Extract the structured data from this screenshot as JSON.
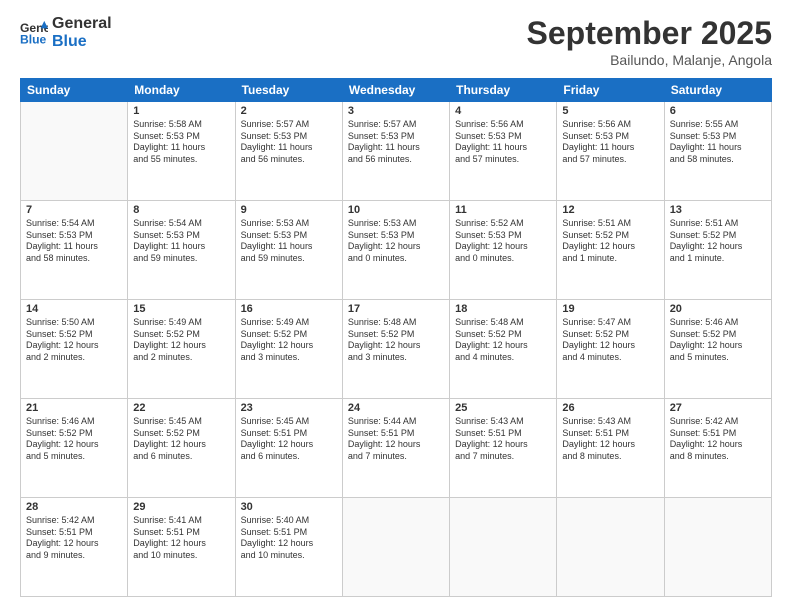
{
  "header": {
    "logo_line1": "General",
    "logo_line2": "Blue",
    "month_title": "September 2025",
    "location": "Bailundo, Malanje, Angola"
  },
  "days_of_week": [
    "Sunday",
    "Monday",
    "Tuesday",
    "Wednesday",
    "Thursday",
    "Friday",
    "Saturday"
  ],
  "weeks": [
    [
      {
        "day": "",
        "info": ""
      },
      {
        "day": "1",
        "info": "Sunrise: 5:58 AM\nSunset: 5:53 PM\nDaylight: 11 hours\nand 55 minutes."
      },
      {
        "day": "2",
        "info": "Sunrise: 5:57 AM\nSunset: 5:53 PM\nDaylight: 11 hours\nand 56 minutes."
      },
      {
        "day": "3",
        "info": "Sunrise: 5:57 AM\nSunset: 5:53 PM\nDaylight: 11 hours\nand 56 minutes."
      },
      {
        "day": "4",
        "info": "Sunrise: 5:56 AM\nSunset: 5:53 PM\nDaylight: 11 hours\nand 57 minutes."
      },
      {
        "day": "5",
        "info": "Sunrise: 5:56 AM\nSunset: 5:53 PM\nDaylight: 11 hours\nand 57 minutes."
      },
      {
        "day": "6",
        "info": "Sunrise: 5:55 AM\nSunset: 5:53 PM\nDaylight: 11 hours\nand 58 minutes."
      }
    ],
    [
      {
        "day": "7",
        "info": "Sunrise: 5:54 AM\nSunset: 5:53 PM\nDaylight: 11 hours\nand 58 minutes."
      },
      {
        "day": "8",
        "info": "Sunrise: 5:54 AM\nSunset: 5:53 PM\nDaylight: 11 hours\nand 59 minutes."
      },
      {
        "day": "9",
        "info": "Sunrise: 5:53 AM\nSunset: 5:53 PM\nDaylight: 11 hours\nand 59 minutes."
      },
      {
        "day": "10",
        "info": "Sunrise: 5:53 AM\nSunset: 5:53 PM\nDaylight: 12 hours\nand 0 minutes."
      },
      {
        "day": "11",
        "info": "Sunrise: 5:52 AM\nSunset: 5:53 PM\nDaylight: 12 hours\nand 0 minutes."
      },
      {
        "day": "12",
        "info": "Sunrise: 5:51 AM\nSunset: 5:52 PM\nDaylight: 12 hours\nand 1 minute."
      },
      {
        "day": "13",
        "info": "Sunrise: 5:51 AM\nSunset: 5:52 PM\nDaylight: 12 hours\nand 1 minute."
      }
    ],
    [
      {
        "day": "14",
        "info": "Sunrise: 5:50 AM\nSunset: 5:52 PM\nDaylight: 12 hours\nand 2 minutes."
      },
      {
        "day": "15",
        "info": "Sunrise: 5:49 AM\nSunset: 5:52 PM\nDaylight: 12 hours\nand 2 minutes."
      },
      {
        "day": "16",
        "info": "Sunrise: 5:49 AM\nSunset: 5:52 PM\nDaylight: 12 hours\nand 3 minutes."
      },
      {
        "day": "17",
        "info": "Sunrise: 5:48 AM\nSunset: 5:52 PM\nDaylight: 12 hours\nand 3 minutes."
      },
      {
        "day": "18",
        "info": "Sunrise: 5:48 AM\nSunset: 5:52 PM\nDaylight: 12 hours\nand 4 minutes."
      },
      {
        "day": "19",
        "info": "Sunrise: 5:47 AM\nSunset: 5:52 PM\nDaylight: 12 hours\nand 4 minutes."
      },
      {
        "day": "20",
        "info": "Sunrise: 5:46 AM\nSunset: 5:52 PM\nDaylight: 12 hours\nand 5 minutes."
      }
    ],
    [
      {
        "day": "21",
        "info": "Sunrise: 5:46 AM\nSunset: 5:52 PM\nDaylight: 12 hours\nand 5 minutes."
      },
      {
        "day": "22",
        "info": "Sunrise: 5:45 AM\nSunset: 5:52 PM\nDaylight: 12 hours\nand 6 minutes."
      },
      {
        "day": "23",
        "info": "Sunrise: 5:45 AM\nSunset: 5:51 PM\nDaylight: 12 hours\nand 6 minutes."
      },
      {
        "day": "24",
        "info": "Sunrise: 5:44 AM\nSunset: 5:51 PM\nDaylight: 12 hours\nand 7 minutes."
      },
      {
        "day": "25",
        "info": "Sunrise: 5:43 AM\nSunset: 5:51 PM\nDaylight: 12 hours\nand 7 minutes."
      },
      {
        "day": "26",
        "info": "Sunrise: 5:43 AM\nSunset: 5:51 PM\nDaylight: 12 hours\nand 8 minutes."
      },
      {
        "day": "27",
        "info": "Sunrise: 5:42 AM\nSunset: 5:51 PM\nDaylight: 12 hours\nand 8 minutes."
      }
    ],
    [
      {
        "day": "28",
        "info": "Sunrise: 5:42 AM\nSunset: 5:51 PM\nDaylight: 12 hours\nand 9 minutes."
      },
      {
        "day": "29",
        "info": "Sunrise: 5:41 AM\nSunset: 5:51 PM\nDaylight: 12 hours\nand 10 minutes."
      },
      {
        "day": "30",
        "info": "Sunrise: 5:40 AM\nSunset: 5:51 PM\nDaylight: 12 hours\nand 10 minutes."
      },
      {
        "day": "",
        "info": ""
      },
      {
        "day": "",
        "info": ""
      },
      {
        "day": "",
        "info": ""
      },
      {
        "day": "",
        "info": ""
      }
    ]
  ]
}
